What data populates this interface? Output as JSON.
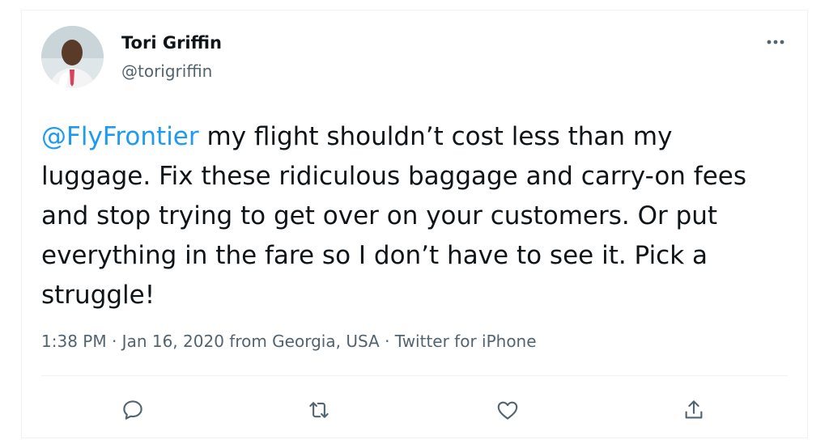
{
  "tweet": {
    "author_name": "Tori Griffin",
    "author_handle": "@torigriffin",
    "mention": "@FlyFrontier",
    "body": " my flight shouldn’t cost less than my luggage. Fix these ridiculous baggage and carry-on fees and stop trying to get over on your customers. Or put everything in the fare so I don’t have to see it. Pick a struggle!",
    "time": "1:38 PM",
    "date": "Jan 16, 2020",
    "location": "from Georgia, USA",
    "source": "Twitter for iPhone",
    "separator": "·"
  },
  "icons": {
    "more": "more-horizontal-icon",
    "reply": "reply-icon",
    "retweet": "retweet-icon",
    "like": "like-icon",
    "share": "share-icon"
  },
  "colors": {
    "link": "#1d9bf0",
    "text": "#0f1419",
    "secondary": "#536471",
    "divider": "#eff3f4"
  }
}
